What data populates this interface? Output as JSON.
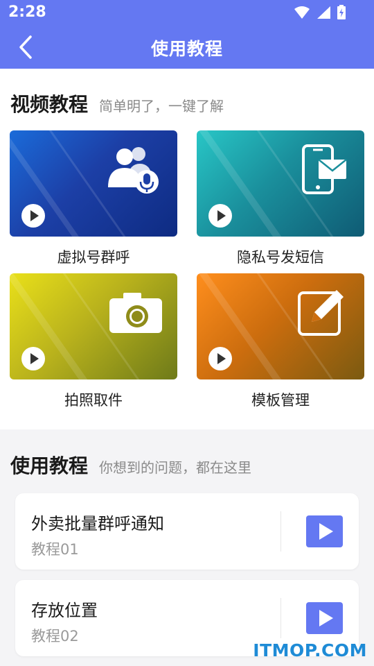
{
  "status_bar": {
    "time": "2:28"
  },
  "app_bar": {
    "title": "使用教程"
  },
  "video_section": {
    "title": "视频教程",
    "subtitle": "简单明了，一键了解",
    "cards": [
      {
        "label": "虚拟号群呼",
        "icon": "contacts-mic-icon"
      },
      {
        "label": "隐私号发短信",
        "icon": "phone-message-icon"
      },
      {
        "label": "拍照取件",
        "icon": "camera-icon"
      },
      {
        "label": "模板管理",
        "icon": "edit-icon"
      }
    ]
  },
  "tutorial_section": {
    "title": "使用教程",
    "subtitle": "你想到的问题，都在这里",
    "items": [
      {
        "title": "外卖批量群呼通知",
        "subtitle": "教程01"
      },
      {
        "title": "存放位置",
        "subtitle": "教程02"
      }
    ]
  },
  "watermark": "ITMOP.COM",
  "colors": {
    "primary": "#6478f2",
    "background": "#f4f4f6",
    "watermark": "#1e8bd6"
  }
}
